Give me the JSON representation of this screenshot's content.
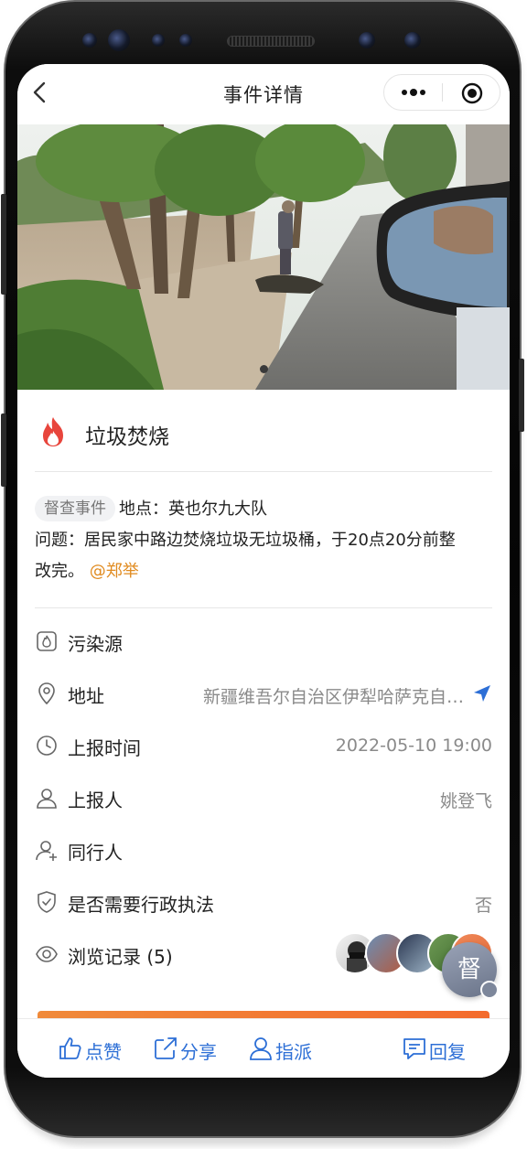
{
  "header": {
    "title": "事件详情"
  },
  "event": {
    "title": "垃圾焚烧",
    "badge": "督查事件",
    "location_line": "地点：英也尔九大队",
    "problem_line": "问题：居民家中路边焚烧垃圾无垃圾桶，于20点20分前整",
    "problem_cont": "改完。",
    "mention": "@郑举"
  },
  "details": {
    "pollution_label": "污染源",
    "address_label": "地址",
    "address_value": "新疆维吾尔自治区伊犁哈萨克自治州",
    "time_label": "上报时间",
    "time_value": "2022-05-10 19:00",
    "reporter_label": "上报人",
    "reporter_value": "姚登飞",
    "companion_label": "同行人",
    "enforcement_label": "是否需要行政执法",
    "enforcement_value": "否",
    "views_label": "浏览记录 (5)"
  },
  "floating": {
    "supervise_label": "督"
  },
  "actions": {
    "like": "点赞",
    "share": "分享",
    "assign": "指派",
    "reply": "回复"
  },
  "colors": {
    "accent_blue": "#2d6fd6",
    "mention_orange": "#e08a1e",
    "fire_red": "#e8453c",
    "bar_orange": "#f36b2c"
  },
  "icons": {
    "back": "chevron-left-icon",
    "more": "more-icon",
    "target": "target-icon",
    "fire": "fire-icon",
    "pollution": "pollution-source-icon",
    "address": "location-pin-icon",
    "navigate": "navigate-arrow-icon",
    "time": "clock-icon",
    "reporter": "user-icon",
    "companion": "user-add-icon",
    "enforcement": "shield-check-icon",
    "views": "eye-icon",
    "like": "thumbs-up-icon",
    "share": "share-icon",
    "assign": "user-icon",
    "reply": "message-icon"
  }
}
